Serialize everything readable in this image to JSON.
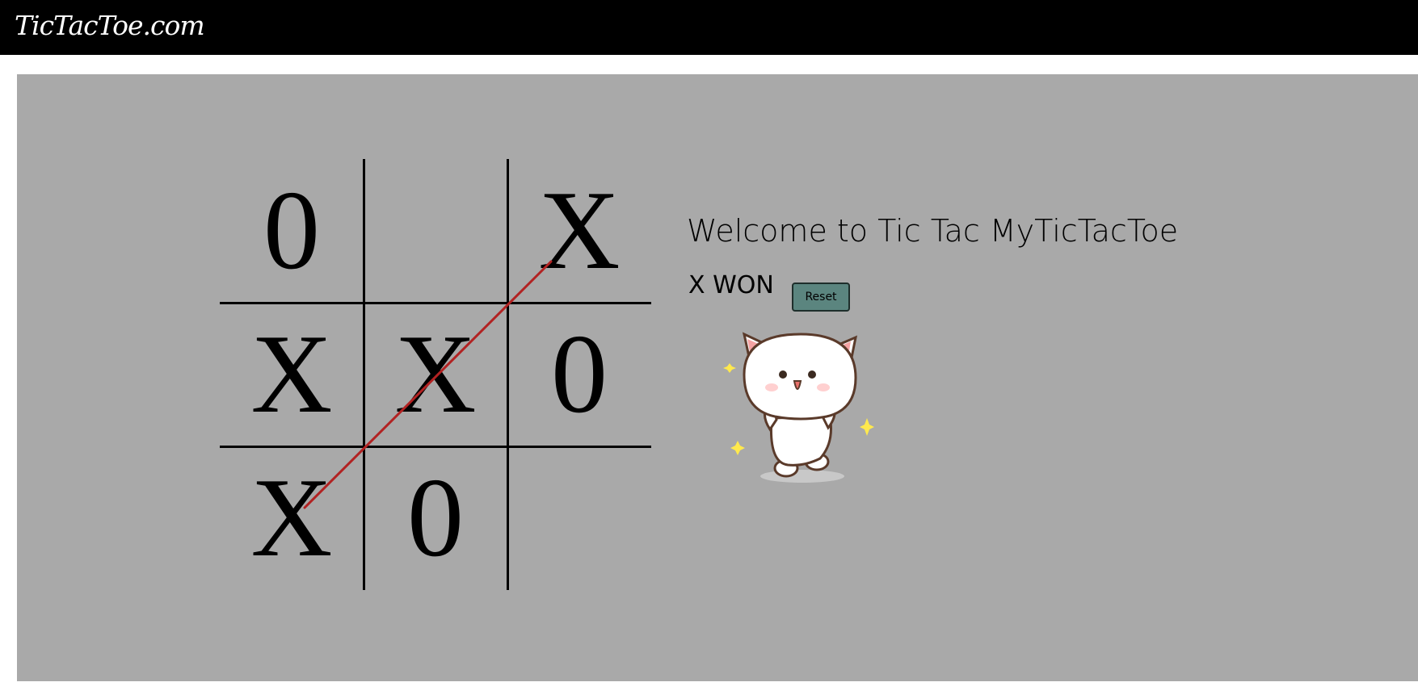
{
  "site": {
    "brand": "TicTacToe.com"
  },
  "game": {
    "board": [
      [
        "0",
        "",
        "X"
      ],
      [
        "X",
        "X",
        "0"
      ],
      [
        "X",
        "0",
        ""
      ]
    ],
    "winning_line": "anti-diagonal",
    "win_line_color": "#b22222"
  },
  "info": {
    "welcome": "Welcome to Tic Tac MyTicTacToe",
    "status": "X WON",
    "reset_label": "Reset"
  },
  "colors": {
    "navbar": "#000000",
    "panel": "#a9a9a9",
    "reset_button": "#5b857f"
  },
  "image": {
    "name": "celebrating-cat-icon"
  }
}
